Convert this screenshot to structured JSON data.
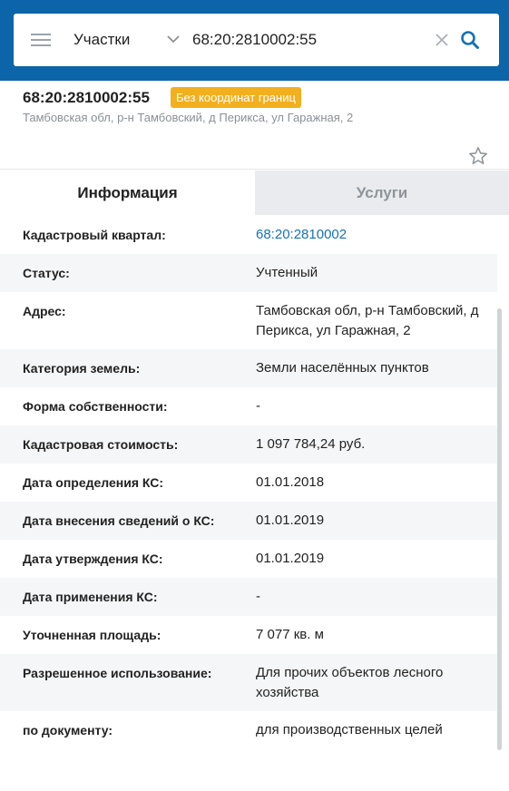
{
  "search": {
    "category": "Участки",
    "query": "68:20:2810002:55"
  },
  "object": {
    "number": "68:20:2810002:55",
    "badge": "Без координат границ",
    "address": "Тамбовская обл, р-н Тамбовский, д Перикса, ул Гаражная, 2"
  },
  "tabs": {
    "info": "Информация",
    "services": "Услуги"
  },
  "info": {
    "rows": [
      {
        "label": "Кадастровый квартал:",
        "value": "68:20:2810002"
      },
      {
        "label": "Статус:",
        "value": "Учтенный"
      },
      {
        "label": "Адрес:",
        "value": "Тамбовская обл, р-н Тамбовский, д Перикса, ул Гаражная, 2"
      },
      {
        "label": "Категория земель:",
        "value": "Земли населённых пунктов"
      },
      {
        "label": "Форма собственности:",
        "value": "-"
      },
      {
        "label": "Кадастровая стоимость:",
        "value": "1 097 784,24 руб."
      },
      {
        "label": "Дата определения КС:",
        "value": "01.01.2018"
      },
      {
        "label": "Дата внесения сведений о КС:",
        "value": "01.01.2019"
      },
      {
        "label": "Дата утверждения КС:",
        "value": "01.01.2019"
      },
      {
        "label": "Дата применения КС:",
        "value": "-"
      },
      {
        "label": "Уточненная площадь:",
        "value": "7 077 кв. м"
      },
      {
        "label": "Разрешенное использование:",
        "value": "Для прочих объектов лесного хозяйства"
      },
      {
        "label": "по документу:",
        "value": "для производственных целей"
      }
    ]
  },
  "colors": {
    "header_bg": "#0c65a8",
    "badge_bg": "#f2b01e",
    "link": "#1372b8"
  },
  "icons": [
    "menu-icon",
    "chevron-down-icon",
    "clear-icon",
    "search-icon",
    "star-icon"
  ]
}
